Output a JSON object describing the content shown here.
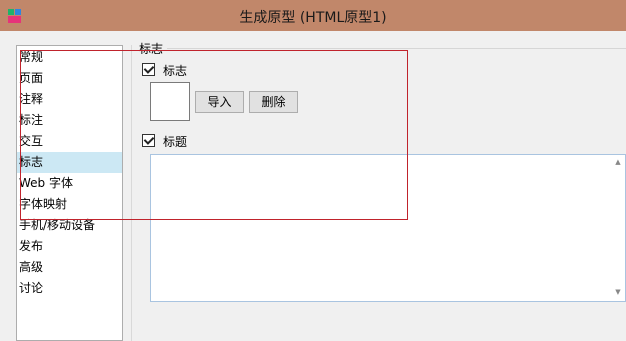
{
  "window": {
    "title": "生成原型 (HTML原型1)",
    "accent_color": "#c1876a"
  },
  "nav": {
    "items": [
      {
        "label": "常规"
      },
      {
        "label": "页面"
      },
      {
        "label": "注释"
      },
      {
        "label": "标注"
      },
      {
        "label": "交互"
      },
      {
        "label": "标志",
        "selected": true
      },
      {
        "label": "Web 字体"
      },
      {
        "label": "字体映射"
      },
      {
        "label": "手机/移动设备"
      },
      {
        "label": "发布"
      },
      {
        "label": "高级"
      },
      {
        "label": "讨论"
      }
    ],
    "selected_color": "#cce8f4"
  },
  "logo_section": {
    "title": "标志",
    "logo_checkbox": {
      "label": "标志",
      "checked": true
    },
    "import_button": "导入",
    "delete_button": "删除",
    "title_checkbox": {
      "label": "标题",
      "checked": true
    },
    "title_text": ""
  },
  "highlight_color": "#c0232c"
}
